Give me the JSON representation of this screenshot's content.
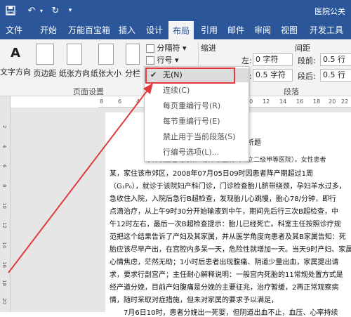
{
  "window": {
    "doc_title": "医院公关"
  },
  "tabs": [
    "文件",
    "开始",
    "万能百宝箱",
    "插入",
    "设计",
    "布局",
    "引用",
    "邮件",
    "审阅",
    "视图",
    "开发工具"
  ],
  "ribbon": {
    "text_direction": "文字方向",
    "margins": "页边距",
    "orientation": "纸张方向",
    "size": "纸张大小",
    "columns": "分栏",
    "breaks": "分隔符",
    "line_numbers": "行号",
    "hyphen_label": "断",
    "indent_title": "缩进",
    "indent_left_label": "左:",
    "indent_left_value": "0 字符",
    "indent_right_label": "右:",
    "indent_right_value": "0.5 字符",
    "spacing_title": "间距",
    "spacing_before_label": "段前:",
    "spacing_before_value": "0.5 行",
    "spacing_after_label": "段后:",
    "spacing_after_value": "0.5 行",
    "group_page_setup": "页面设置",
    "group_paragraph": "段落"
  },
  "menu": {
    "items": [
      {
        "label": "无(N)",
        "checked": true
      },
      {
        "label": "连续(C)",
        "checked": false
      },
      {
        "label": "每页重编行号(R)",
        "checked": false
      },
      {
        "label": "每节重编行号(E)",
        "checked": false
      },
      {
        "label": "禁止用于当前段落(S)",
        "checked": false
      },
      {
        "label": "行编号选项(L)...",
        "checked": false
      }
    ]
  },
  "ruler": {
    "h_ticks": [
      "8",
      "6",
      "4",
      "2",
      "2",
      "4",
      "6",
      "8",
      "10",
      "12",
      "14",
      "16",
      "18",
      "20",
      "22"
    ],
    "v_ticks": [
      "2",
      "4",
      "6",
      "8",
      "10",
      "12",
      "14",
      "16",
      "18",
      "20"
    ]
  },
  "document": {
    "lines": [
      "案例分析题",
      "某，家住该市郊区，2008年07月05日09时因患者阵产期超过1周",
      "（G₁P₀），就诊于该院妇产科门诊，门诊检查胎儿脐带绕颈，孕妇羊水过多，",
      "急收住入院，入院后急行B超检查，发现胎儿心跳慢，胎心78/分钟，即行",
      "点滴治疗，从上午9时30分开始输液到中午，期间先后行三次B超检查，中",
      "午12时左右，最后一次B超检查提示：胎儿已经死亡。科室主任按照诊疗规",
      "范把这个结果告诉了产妇及其家属，并从医学角度向患者及其B家属告知：死",
      "胎应该尽早产出，在宫腔内多呆一天，危险性就增加一天。当天9时产妇、家属",
      "心情焦虑，茫然无助；1小时后患者出现腹痛、阴道少量出血，家属提出请",
      "求，要求行剖宫产；主任耐心解释说明：一般宫内死胎的11常规处置方式是",
      "经产道分娩，目前产妇腹痛是分娩的主要征兆，治疗暂缓，2再正常观察病",
      "情，随时采取对症措施，但未对家属的要求予以满足，",
      "7月6日10时，患者分娩出一死婴，但阴道出血不止，血压、心率持续"
    ],
    "partial_line": "事件发生在北方某一家市级医院（公立二级甲等医院）。女性患者"
  }
}
